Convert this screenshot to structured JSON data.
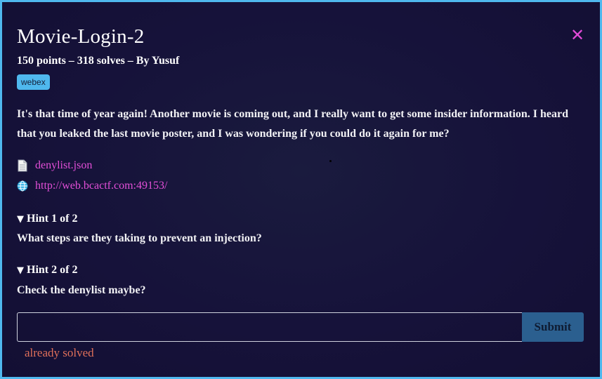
{
  "challenge": {
    "title": "Movie-Login-2",
    "meta": "150 points – 318 solves – By Yusuf",
    "tag": "webex",
    "description": "It's that time of year again! Another movie is coming out, and I really want to get some insider information. I heard that you leaked the last movie poster, and I was wondering if you could do it again for me?",
    "close_icon": "close-icon",
    "close_color": "#e24ad8"
  },
  "files": [
    {
      "icon": "document-icon",
      "label": "denylist.json"
    },
    {
      "icon": "globe-icon",
      "label": "http://web.bcactf.com:49153/"
    }
  ],
  "hints": [
    {
      "title": "Hint 1 of 2",
      "body": "What steps are they taking to prevent an injection?"
    },
    {
      "title": "Hint 2 of 2",
      "body": "Check the denylist maybe?"
    }
  ],
  "form": {
    "input_value": "",
    "submit_label": "Submit",
    "status": "already solved"
  },
  "colors": {
    "border": "#4fb8ee",
    "link": "#e34fd8",
    "status": "#e0705a",
    "submit_bg": "#2b5f8f"
  }
}
